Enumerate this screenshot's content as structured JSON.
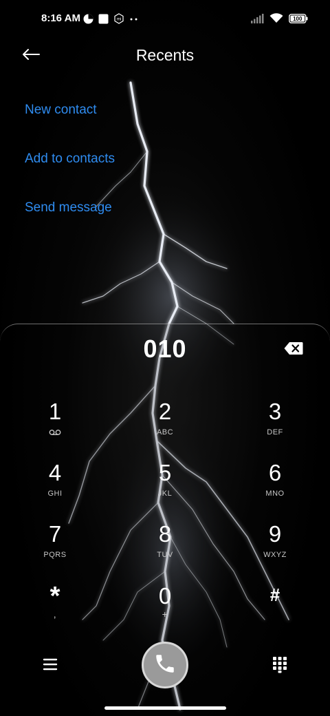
{
  "status_bar": {
    "time": "8:16 AM",
    "left_icons": [
      "app-notification-icon",
      "square-notification-icon",
      "mi-icon",
      "more-dots-icon"
    ],
    "right_icons": [
      "signal-icon",
      "wifi-icon",
      "battery-icon"
    ],
    "battery": "100"
  },
  "header": {
    "title": "Recents"
  },
  "menu": {
    "new_contact": "New contact",
    "add_to_contacts": "Add to contacts",
    "send_message": "Send message"
  },
  "dialer": {
    "number": "010",
    "keys": [
      {
        "digit": "1",
        "letters": ""
      },
      {
        "digit": "2",
        "letters": "ABC"
      },
      {
        "digit": "3",
        "letters": "DEF"
      },
      {
        "digit": "4",
        "letters": "GHI"
      },
      {
        "digit": "5",
        "letters": "JKL"
      },
      {
        "digit": "6",
        "letters": "MNO"
      },
      {
        "digit": "7",
        "letters": "PQRS"
      },
      {
        "digit": "8",
        "letters": "TUV"
      },
      {
        "digit": "9",
        "letters": "WXYZ"
      },
      {
        "digit": "*",
        "letters": ","
      },
      {
        "digit": "0",
        "letters": "+"
      },
      {
        "digit": "#",
        "letters": ""
      }
    ]
  },
  "colors": {
    "accent": "#2f8cf0",
    "call_button": "#9a9a9a"
  }
}
